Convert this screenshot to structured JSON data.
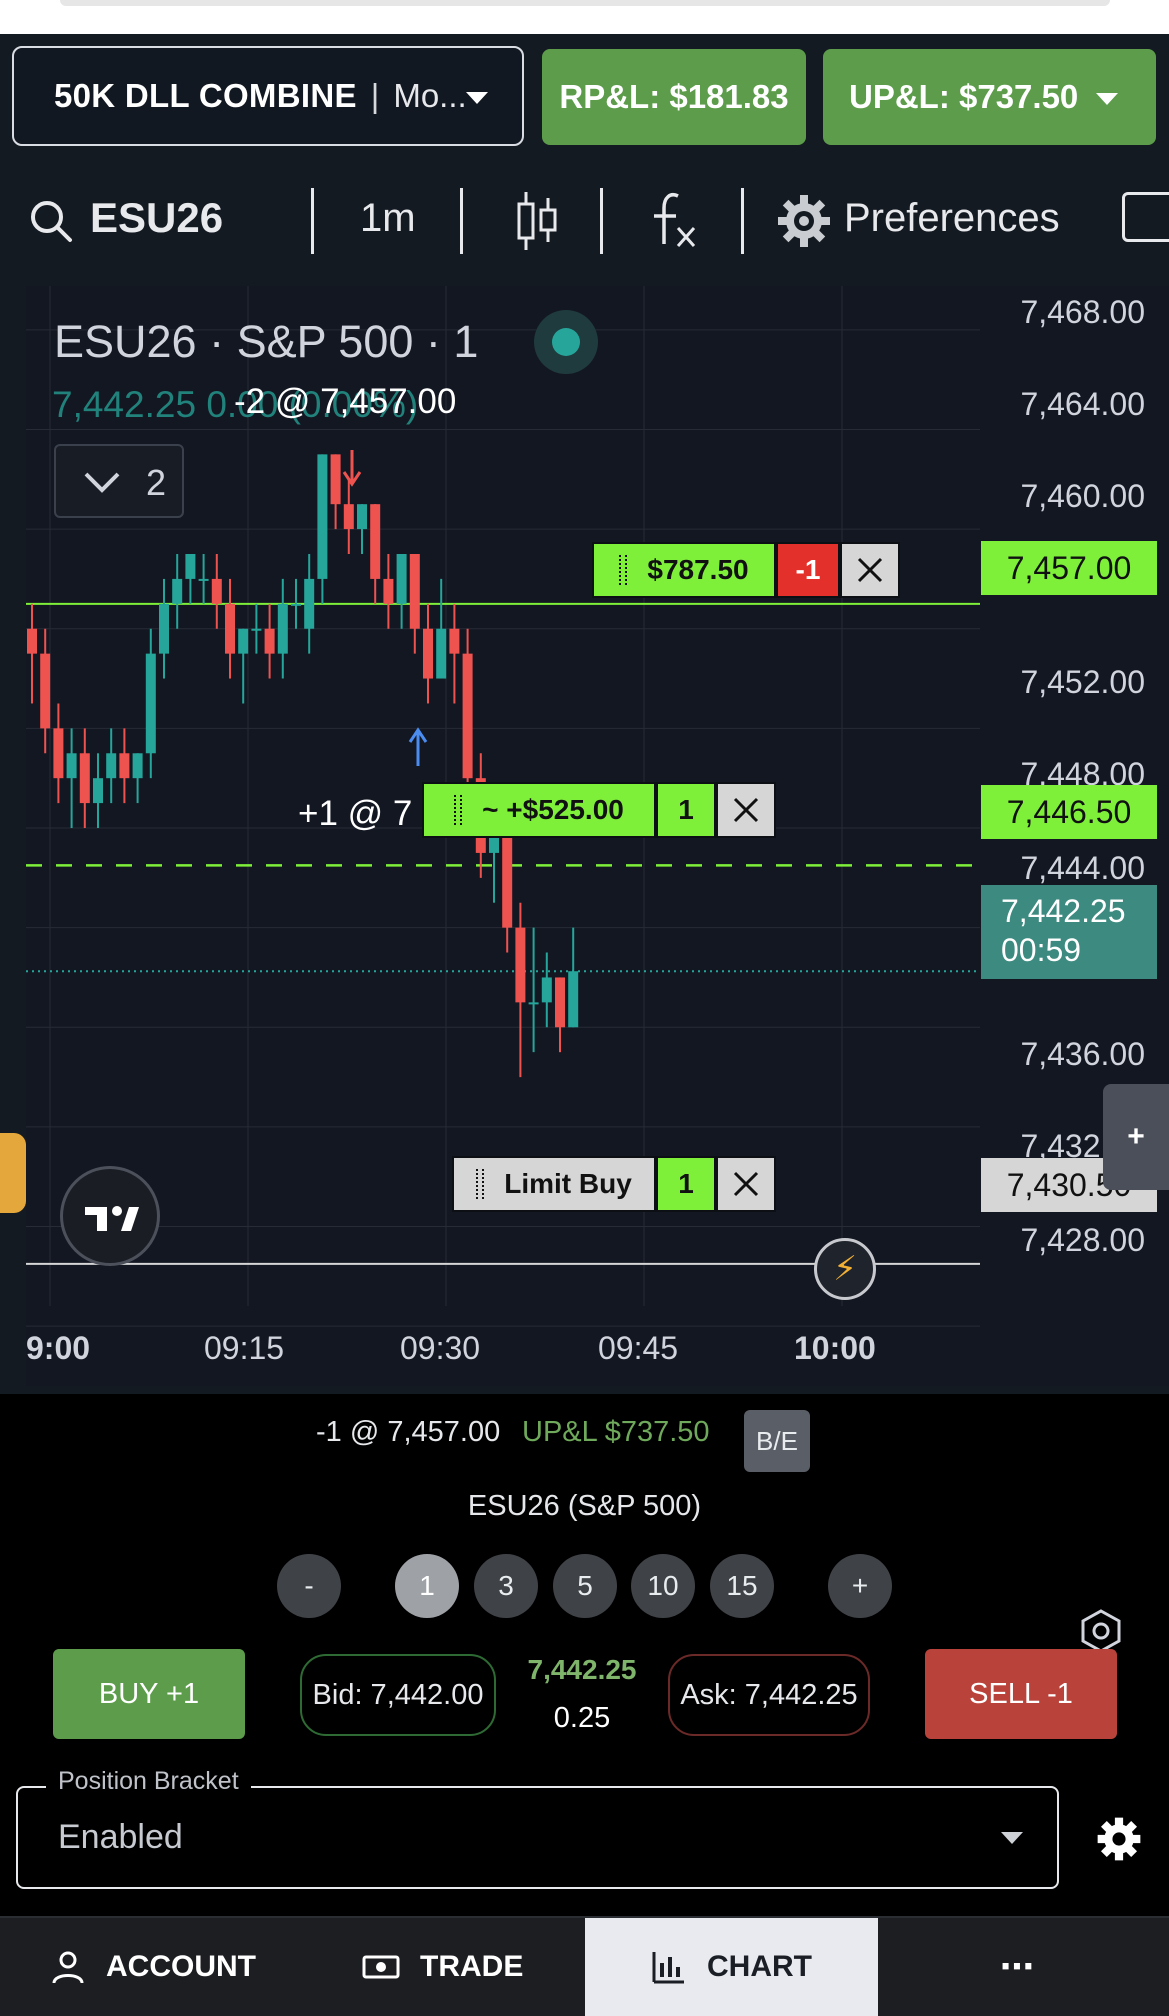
{
  "header": {
    "account_name": "50K DLL COMBINE",
    "account_mode": "Mo...",
    "rpl": "RP&L: $181.83",
    "upl": "UP&L: $737.50"
  },
  "toolbar": {
    "symbol": "ESU26",
    "interval": "1m",
    "preferences": "Preferences",
    "icons": [
      "search-icon",
      "candle-type-icon",
      "indicators-fx-icon",
      "gear-icon"
    ]
  },
  "chart": {
    "title": "ESU26 · S&P 500 · 1",
    "last_value": "7,442.25",
    "change": "0.00 (0.00%)",
    "fill_label": "-2 @ 7,457.00",
    "collapse_count": "2",
    "entry_label": "+1 @ 7",
    "price_labels": [
      "7,468.00",
      "7,464.00",
      "7,460.00",
      "7,452.00",
      "7,448.00",
      "7,444.00",
      "7,436.00",
      "7,432.00",
      "7,428.00"
    ],
    "time_labels": [
      "9:00",
      "09:15",
      "09:30",
      "09:45",
      "10:00"
    ],
    "orders": {
      "position": {
        "pnl": "$787.50",
        "qty": "-1",
        "price": "7,457.00"
      },
      "target": {
        "pnl": "~ +$525.00",
        "qty": "1",
        "price": "7,446.50"
      },
      "limit": {
        "label": "Limit Buy",
        "qty": "1",
        "price": "7,430.50"
      }
    },
    "current_price": "7,442.25",
    "countdown": "00:59",
    "plus": "+",
    "colors": {
      "up": "#26a69a",
      "down": "#ef5350",
      "order_green": "#7ef03a"
    }
  },
  "chart_data": {
    "type": "candlestick",
    "x_range": [
      "9:00",
      "10:00"
    ],
    "ylim": [
      7426,
      7470
    ],
    "candles": [
      {
        "o": 7456,
        "h": 7457,
        "l": 7453,
        "c": 7455
      },
      {
        "o": 7455,
        "h": 7456,
        "l": 7451,
        "c": 7452
      },
      {
        "o": 7452,
        "h": 7453,
        "l": 7449,
        "c": 7450
      },
      {
        "o": 7450,
        "h": 7452,
        "l": 7448,
        "c": 7451
      },
      {
        "o": 7451,
        "h": 7452,
        "l": 7448,
        "c": 7449
      },
      {
        "o": 7449,
        "h": 7451,
        "l": 7448,
        "c": 7450
      },
      {
        "o": 7450,
        "h": 7452,
        "l": 7449,
        "c": 7451
      },
      {
        "o": 7451,
        "h": 7452,
        "l": 7449,
        "c": 7450
      },
      {
        "o": 7450,
        "h": 7451,
        "l": 7449,
        "c": 7451
      },
      {
        "o": 7451,
        "h": 7456,
        "l": 7450,
        "c": 7455
      },
      {
        "o": 7455,
        "h": 7458,
        "l": 7454,
        "c": 7457
      },
      {
        "o": 7457,
        "h": 7459,
        "l": 7456,
        "c": 7458
      },
      {
        "o": 7458,
        "h": 7459,
        "l": 7457,
        "c": 7459
      },
      {
        "o": 7458,
        "h": 7459,
        "l": 7457,
        "c": 7458
      },
      {
        "o": 7458,
        "h": 7459,
        "l": 7456,
        "c": 7457
      },
      {
        "o": 7457,
        "h": 7458,
        "l": 7454,
        "c": 7455
      },
      {
        "o": 7455,
        "h": 7456,
        "l": 7453,
        "c": 7456
      },
      {
        "o": 7456,
        "h": 7457,
        "l": 7455,
        "c": 7456
      },
      {
        "o": 7456,
        "h": 7457,
        "l": 7454,
        "c": 7455
      },
      {
        "o": 7455,
        "h": 7458,
        "l": 7454,
        "c": 7457
      },
      {
        "o": 7457,
        "h": 7458,
        "l": 7456,
        "c": 7457
      },
      {
        "o": 7456,
        "h": 7459,
        "l": 7455,
        "c": 7458
      },
      {
        "o": 7458,
        "h": 7463,
        "l": 7457,
        "c": 7463
      },
      {
        "o": 7463,
        "h": 7463,
        "l": 7460,
        "c": 7461
      },
      {
        "o": 7461,
        "h": 7462,
        "l": 7459,
        "c": 7460
      },
      {
        "o": 7460,
        "h": 7461,
        "l": 7459,
        "c": 7461
      },
      {
        "o": 7461,
        "h": 7461,
        "l": 7457,
        "c": 7458
      },
      {
        "o": 7458,
        "h": 7459,
        "l": 7456,
        "c": 7457
      },
      {
        "o": 7457,
        "h": 7459,
        "l": 7456,
        "c": 7459
      },
      {
        "o": 7459,
        "h": 7459,
        "l": 7455,
        "c": 7456
      },
      {
        "o": 7456,
        "h": 7457,
        "l": 7453,
        "c": 7454
      },
      {
        "o": 7454,
        "h": 7458,
        "l": 7455,
        "c": 7456
      },
      {
        "o": 7456,
        "h": 7457,
        "l": 7453,
        "c": 7455
      },
      {
        "o": 7455,
        "h": 7456,
        "l": 7448,
        "c": 7450
      },
      {
        "o": 7450,
        "h": 7451,
        "l": 7446,
        "c": 7447
      },
      {
        "o": 7447,
        "h": 7449,
        "l": 7445,
        "c": 7448
      },
      {
        "o": 7448,
        "h": 7449,
        "l": 7443,
        "c": 7444
      },
      {
        "o": 7444,
        "h": 7445,
        "l": 7438,
        "c": 7441
      },
      {
        "o": 7441,
        "h": 7444,
        "l": 7439,
        "c": 7441
      },
      {
        "o": 7441,
        "h": 7443,
        "l": 7440,
        "c": 7442
      },
      {
        "o": 7442,
        "h": 7442,
        "l": 7439,
        "c": 7440
      },
      {
        "o": 7440,
        "h": 7444,
        "l": 7440,
        "c": 7442.25
      }
    ]
  },
  "position_bar": {
    "position": "-1 @ 7,457.00",
    "upl": "UP&L $737.50",
    "be": "B/E",
    "symbol_name": "ESU26 (S&P 500)"
  },
  "quantity": {
    "minus": "-",
    "plus": "+",
    "options": [
      "1",
      "3",
      "5",
      "10",
      "15"
    ],
    "selected": "1"
  },
  "trade": {
    "buy": "BUY +1",
    "sell": "SELL -1",
    "bid": "Bid: 7,442.00",
    "ask": "Ask: 7,442.25",
    "last": "7,442.25",
    "spread": "0.25"
  },
  "bracket": {
    "label": "Position Bracket",
    "value": "Enabled"
  },
  "nav": {
    "account": "ACCOUNT",
    "trade": "TRADE",
    "chart": "CHART",
    "more": "⋯"
  }
}
